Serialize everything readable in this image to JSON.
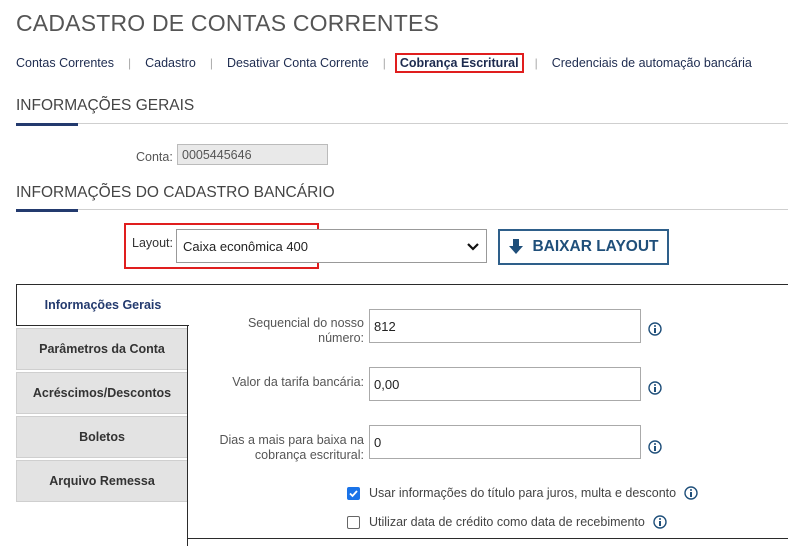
{
  "page": {
    "title": "CADASTRO DE CONTAS CORRENTES"
  },
  "subnav": {
    "items": [
      {
        "label": "Contas Correntes"
      },
      {
        "label": "Cadastro"
      },
      {
        "label": "Desativar Conta Corrente"
      },
      {
        "label": "Cobrança Escritural",
        "active": true
      },
      {
        "label": "Credenciais de automação bancária"
      }
    ],
    "separator": "|"
  },
  "sections": {
    "geral": {
      "title": "INFORMAÇÕES GERAIS"
    },
    "bancario": {
      "title": "INFORMAÇÕES DO CADASTRO BANCÁRIO"
    }
  },
  "conta": {
    "label": "Conta:",
    "value": "0005445646"
  },
  "layout": {
    "label": "Layout:",
    "selected": "Caixa econômica 400",
    "download_label": "BAIXAR LAYOUT"
  },
  "tabs": [
    {
      "label": "Informações Gerais",
      "active": true
    },
    {
      "label": "Parâmetros da Conta"
    },
    {
      "label": "Acréscimos/Descontos"
    },
    {
      "label": "Boletos"
    },
    {
      "label": "Arquivo Remessa"
    }
  ],
  "fields": {
    "sequencial": {
      "label_line1": "Sequencial do nosso",
      "label_line2": "número:",
      "value": "812"
    },
    "tarifa": {
      "label": "Valor da tarifa bancária:",
      "value": "0,00"
    },
    "dias": {
      "label_line1": "Dias a mais para baixa na",
      "label_line2": "cobrança escritural:",
      "value": "0"
    }
  },
  "checkboxes": {
    "usar_info": {
      "label": "Usar informações do título para juros, multa e desconto",
      "checked": true
    },
    "data_credito": {
      "label": "Utilizar data de crédito como data de recebimento",
      "checked": false
    }
  },
  "colors": {
    "accent": "#233a6e",
    "highlight": "#e01e1e",
    "button": "#1f4f7a",
    "checkbox": "#1a73e8"
  },
  "icons": {
    "info": "info-circle-icon",
    "download": "arrow-down-icon",
    "dropdown": "chevron-down-icon",
    "check": "check-icon"
  }
}
